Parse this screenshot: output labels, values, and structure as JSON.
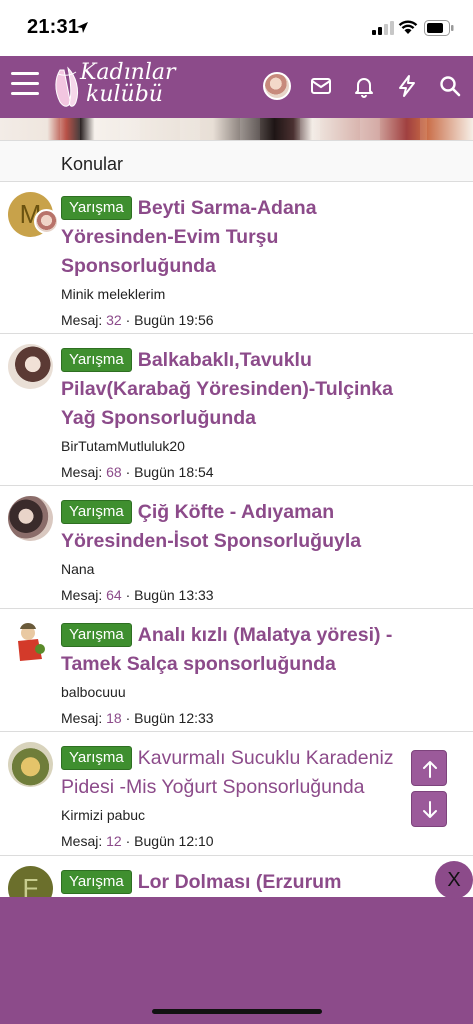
{
  "status_bar": {
    "time": "21:31"
  },
  "header": {
    "logo_line1": "Kadınlar",
    "logo_line2": "kulübü"
  },
  "section": {
    "title": "Konular"
  },
  "threads": [
    {
      "prefix": "Yarışma",
      "title": "Beyti Sarma-Adana Yöresinden-Evim Turşu Sponsorluğunda",
      "author": "Minik meleklerim",
      "meta_label": "Mesaj:",
      "replies": "32",
      "separator": "·",
      "time": "Bugün 19:56",
      "avatar_letter": "M"
    },
    {
      "prefix": "Yarışma",
      "title": "Balkabaklı,Tavuklu Pilav(Karabağ Yöresinden)-Tulçinka Yağ Sponsorluğunda",
      "author": "BirTutamMutluluk20",
      "meta_label": "Mesaj:",
      "replies": "68",
      "separator": "·",
      "time": "Bugün 18:54"
    },
    {
      "prefix": "Yarışma",
      "title": "Çiğ Köfte - Adıyaman Yöresinden-İsot Sponsorluğuyla",
      "author": "Nana",
      "meta_label": "Mesaj:",
      "replies": "64",
      "separator": "·",
      "time": "Bugün 13:33"
    },
    {
      "prefix": "Yarışma",
      "title": "Analı kızlı (Malatya yöresi) - Tamek Salça sponsorluğunda",
      "author": "balbocuuu",
      "meta_label": "Mesaj:",
      "replies": "18",
      "separator": "·",
      "time": "Bugün 12:33"
    },
    {
      "prefix": "Yarışma",
      "title": "Kavurmalı Sucuklu Karadeniz Pidesi -Mis Yoğurt Sponsorluğunda",
      "author": "Kirmizi pabuc",
      "meta_label": "Mesaj:",
      "replies": "12",
      "separator": "·",
      "time": "Bugün 12:10"
    },
    {
      "prefix": "Yarışma",
      "title": "Lor Dolması (Erzurum",
      "avatar_letter": "F"
    }
  ],
  "close_label": "X",
  "colors": {
    "brand": "#8c4b8a",
    "prefix_green": "#3f8f2f"
  }
}
